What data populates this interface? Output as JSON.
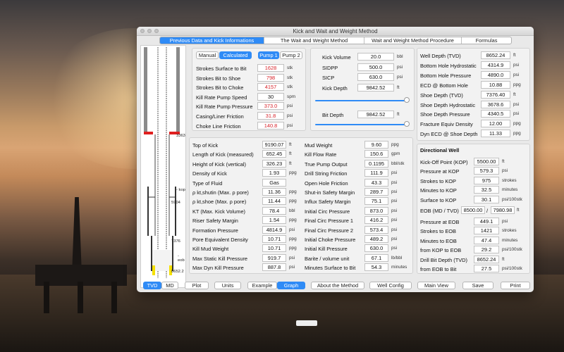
{
  "window": {
    "title": "Kick and Wait and Weight Method"
  },
  "tabs": [
    "Previous Data and Kick Informations",
    "The Wait and Weight Method",
    "Wait and Weight Method Procedure",
    "Formulas"
  ],
  "pump_mode": {
    "manual": "Manual",
    "calculated": "Calculated",
    "pump1": "Pump 1",
    "pump2": "Pump 2"
  },
  "pump_rows": [
    {
      "label": "Strokes Surface to Bit",
      "value": "1628",
      "unit": "stk",
      "red": true
    },
    {
      "label": "Strokes Bit to Shoe",
      "value": "798",
      "unit": "stk",
      "red": true
    },
    {
      "label": "Strokes Bit to Choke",
      "value": "4157",
      "unit": "stk",
      "red": true
    },
    {
      "label": "Kill Rate Pump Speed",
      "value": "30",
      "unit": "spm",
      "red": false
    },
    {
      "label": "Kill Rate Pump Pressure",
      "value": "373.0",
      "unit": "psi",
      "red": true
    },
    {
      "label": "Casing/Liner Friction",
      "value": "31.8",
      "unit": "psi",
      "red": true
    },
    {
      "label": "Choke Line Friction",
      "value": "140.8",
      "unit": "psi",
      "red": true
    }
  ],
  "kick_rows": [
    {
      "label": "Kick Volume",
      "value": "20.0",
      "unit": "bbl"
    },
    {
      "label": "SIDPP",
      "value": "500.0",
      "unit": "psi"
    },
    {
      "label": "SICP",
      "value": "630.0",
      "unit": "psi"
    },
    {
      "label": "Kick Depth",
      "value": "9842.52",
      "unit": "ft"
    }
  ],
  "bit_depth": {
    "label": "Bit Depth",
    "value": "9842.52",
    "unit": "ft"
  },
  "well_rows": [
    {
      "label": "Well Depth (TVD)",
      "value": "8652.24",
      "unit": "ft"
    },
    {
      "label": "Bottom Hole Hydrostatic",
      "value": "4314.9",
      "unit": "psi"
    },
    {
      "label": "Bottom Hole Pressure",
      "value": "4890.0",
      "unit": "psi"
    },
    {
      "label": "ECD @ Bottom Hole",
      "value": "10.88",
      "unit": "ppg"
    },
    {
      "label": "Shoe Depth (TVD)",
      "value": "7376.40",
      "unit": "ft"
    },
    {
      "label": "Shoe Depth Hydrostatic",
      "value": "3678.6",
      "unit": "psi"
    },
    {
      "label": "Shoe Depth Pressure",
      "value": "4340.5",
      "unit": "psi"
    },
    {
      "label": "Fracture Equiv Density",
      "value": "12.00",
      "unit": "ppg"
    },
    {
      "label": "Dyn ECD @ Shoe Depth",
      "value": "11.33",
      "unit": "ppg"
    }
  ],
  "results_left": [
    {
      "label": "Top of Kick",
      "value": "9190.07",
      "unit": "ft"
    },
    {
      "label": "Length of Kick  (measured)",
      "value": "652.45",
      "unit": "ft"
    },
    {
      "label": "Height of Kick  (vertical)",
      "value": "326.23",
      "unit": "ft"
    },
    {
      "label": "Density of Kick",
      "value": "1.93",
      "unit": "ppg"
    },
    {
      "label": "Type of Fluid",
      "value": "Gas",
      "unit": ""
    },
    {
      "label": "ρ kt,shutin (Max. ρ pore)",
      "value": "11.36",
      "unit": "ppg"
    },
    {
      "label": "ρ kt,shoe (Max. ρ pore)",
      "value": "11.44",
      "unit": "ppg"
    },
    {
      "label": "KT  (Max. Kick Volume)",
      "value": "78.4",
      "unit": "bbl"
    },
    {
      "label": "Riser Safety Margin",
      "value": "1.54",
      "unit": "ppg"
    },
    {
      "label": "Formation Pressure",
      "value": "4814.9",
      "unit": "psi"
    },
    {
      "label": "Pore Equivalent Density",
      "value": "10.71",
      "unit": "ppg"
    },
    {
      "label": "Kill Mud Weight",
      "value": "10.71",
      "unit": "ppg"
    },
    {
      "label": "Max Static Kill Pressure",
      "value": "919.7",
      "unit": "psi"
    },
    {
      "label": "Max Dyn Kill Pressure",
      "value": "887.8",
      "unit": "psi"
    }
  ],
  "results_right": [
    {
      "label": "Mud Weight",
      "value": "9.60",
      "unit": "ppg"
    },
    {
      "label": "Kill Flow Rate",
      "value": "150.6",
      "unit": "gpm"
    },
    {
      "label": "True Pump Output",
      "value": "0.1195",
      "unit": "bbl/stk"
    },
    {
      "label": "Drill String Friction",
      "value": "111.9",
      "unit": "psi"
    },
    {
      "label": "Open Hole Friction",
      "value": "43.3",
      "unit": "psi"
    },
    {
      "label": "Shut-in Safety Margin",
      "value": "289.7",
      "unit": "psi"
    },
    {
      "label": "Influx Safety Margin",
      "value": "75.1",
      "unit": "psi"
    },
    {
      "label": "Initial Circ Pressure",
      "value": "873.0",
      "unit": "psi"
    },
    {
      "label": "Final Circ Pressure 1",
      "value": "416.2",
      "unit": "psi"
    },
    {
      "label": "Final Circ Pressure 2",
      "value": "573.4",
      "unit": "psi"
    },
    {
      "label": "Initial Choke Pressure",
      "value": "489.2",
      "unit": "psi"
    },
    {
      "label": "Initial Kill Pressure",
      "value": "630.0",
      "unit": "psi"
    },
    {
      "label": "Barite / volume unit",
      "value": "67.1",
      "unit": "lb/bbl"
    },
    {
      "label": "Minutes Surface to Bit",
      "value": "54.3",
      "unit": "minutes"
    }
  ],
  "directional": {
    "title": "Directional Well",
    "kop_rows": [
      {
        "label": "Kick-Off Point (KOP)",
        "value": "5500.00",
        "unit": "ft"
      },
      {
        "label": "Pressure at KOP",
        "value": "579.3",
        "unit": "psi"
      },
      {
        "label": "Strokes to KOP",
        "value": "975",
        "unit": "strokes"
      },
      {
        "label": "Minutes to KOP",
        "value": "32.5",
        "unit": "minutes"
      },
      {
        "label": "Surface to KOP",
        "value": "30.1",
        "unit": "psi/100stk"
      }
    ],
    "eob": {
      "label": "EOB (MD / TVD)",
      "md": "8500.00",
      "sep": "/",
      "tvd": "7980.98",
      "unit": "ft"
    },
    "eob_rows": [
      {
        "label": "Pressure at EOB",
        "value": "449.1",
        "unit": "psi"
      },
      {
        "label": "Strokes to EOB",
        "value": "1421",
        "unit": "strokes"
      },
      {
        "label": "Minutes to EOB",
        "value": "47.4",
        "unit": "minutes"
      },
      {
        "label": "from KOP to EOB",
        "value": "29.2",
        "unit": "psi/100stk"
      }
    ],
    "bit_rows": [
      {
        "label": "Drill Bit Depth (TVD)",
        "value": "8652.24",
        "unit": "ft"
      },
      {
        "label": "from EOB to Bit",
        "value": "27.5",
        "unit": "psi/100stk"
      }
    ]
  },
  "well_labels": {
    "shoe_md": "3363",
    "kop": "- kop",
    "kop_md": "5904",
    "shoe2": "7376",
    "eob": "- eob",
    "bit": "8652.2"
  },
  "bottom": {
    "tvd": "TVD",
    "md": "MD",
    "plot": "Plot",
    "units": "Units",
    "example": "Example",
    "graph": "Graph",
    "about": "About the Method",
    "well_config": "Well Config",
    "main_view": "Main View",
    "save": "Save",
    "print": "Print"
  },
  "colors": {
    "accent": "#2f8bf6",
    "alert": "#d8232a"
  }
}
